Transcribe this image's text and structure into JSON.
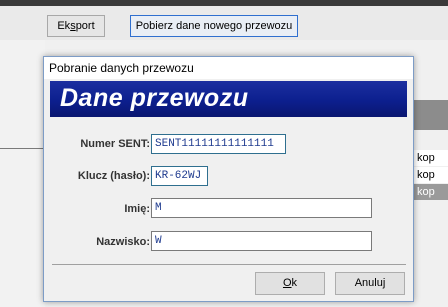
{
  "toolbar": {
    "eksport_pre": "Ek",
    "eksport_ul": "s",
    "eksport_post": "port",
    "pobierz_label": "Pobierz dane nowego przewozu"
  },
  "background": {
    "kop_items": [
      "kop",
      "kop",
      "kop"
    ]
  },
  "dialog": {
    "title": "Pobranie danych przewozu",
    "banner": "Dane przewozu",
    "fields": {
      "sent_label": "Numer SENT:",
      "sent_value": "SENT11111111111111",
      "klucz_label": "Klucz (hasło):",
      "klucz_value": "KR-62WJ",
      "imie_label": "Imię:",
      "imie_value": "M",
      "nazwisko_label": "Nazwisko:",
      "nazwisko_value": "W"
    },
    "buttons": {
      "ok_ul": "O",
      "ok_post": "k",
      "anuluj": "Anuluj"
    }
  }
}
